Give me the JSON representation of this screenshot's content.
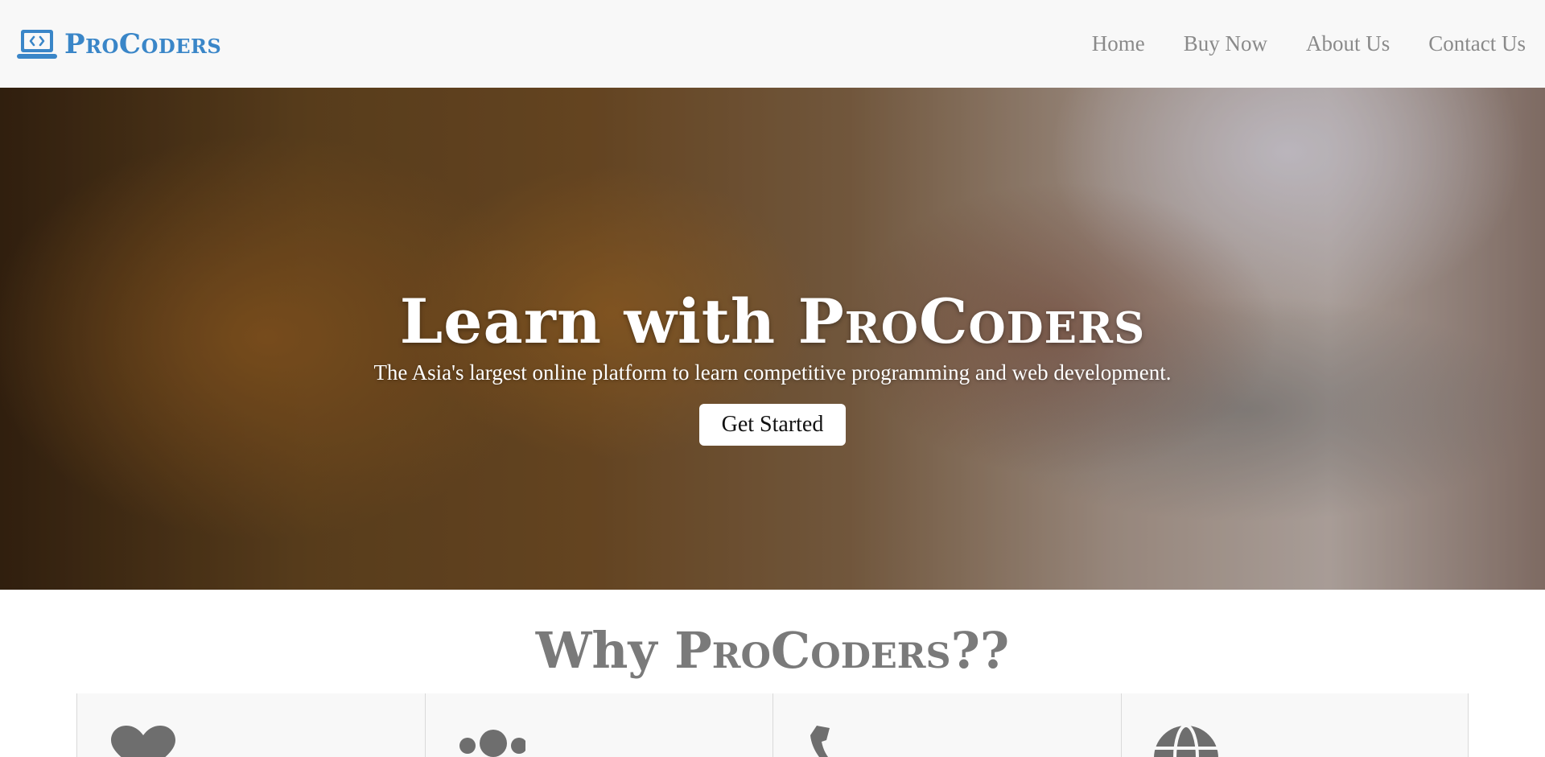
{
  "brand": {
    "name": "ProCoders",
    "icon": "laptop-code-icon",
    "color": "#3a86c8"
  },
  "nav": {
    "items": [
      {
        "label": "Home"
      },
      {
        "label": "Buy Now"
      },
      {
        "label": "About Us"
      },
      {
        "label": "Contact Us"
      }
    ]
  },
  "hero": {
    "title_prefix": "Learn with ",
    "title_brand": "ProCoders",
    "subtitle": "The Asia's largest online platform to learn competitive programming and web development.",
    "cta_label": "Get Started"
  },
  "why": {
    "title_prefix": "Why ",
    "title_brand": "ProCoders",
    "title_suffix": "??",
    "cards": [
      {
        "icon": "heart-icon"
      },
      {
        "icon": "users-icon"
      },
      {
        "icon": "phone-icon"
      },
      {
        "icon": "globe-icon"
      }
    ]
  }
}
